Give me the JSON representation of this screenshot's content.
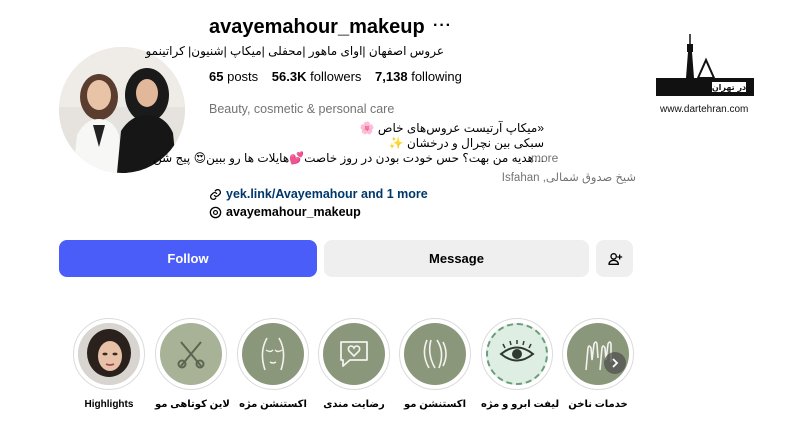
{
  "profile": {
    "username": "avayemahour_makeup",
    "full_name": "عروس اصفهان |اوای ماهور |محفلی |میکاپ |شنیون| کراتینمو",
    "stats": [
      {
        "count": "65",
        "label": "posts"
      },
      {
        "count": "56.3K",
        "label": "followers"
      },
      {
        "count": "7,138",
        "label": "following"
      }
    ],
    "category": "Beauty, cosmetic & personal care",
    "bio_lines": [
      "«میکاپ آرتیست عروس‌های خاص 🌸",
      "سبکی بین نچرال و درخشان ✨",
      "...هدیه من بهت؟ حس خودت بودن در روز خاصت💕هایلات ها رو ببین😍 پیج شن"
    ],
    "bio_more": "more",
    "address": "شیخ صدوق شمالی, Isfahan",
    "link": "yek.link/Avayemahour and 1 more",
    "threads": "avayemahour_makeup"
  },
  "actions": {
    "follow": "Follow",
    "message": "Message"
  },
  "highlights": [
    {
      "label": "Highlights",
      "icon": "portrait-photo"
    },
    {
      "label": "لاین کوتاهی مو",
      "icon": "scissors-comb-icon"
    },
    {
      "label": "اکستنشن مژه",
      "icon": "eyelash-face-icon"
    },
    {
      "label": "رضایت مندی",
      "icon": "heart-chat-icon"
    },
    {
      "label": "اکستنشن مو",
      "icon": "hair-extension-icon"
    },
    {
      "label": "لیفت ابرو و مژه",
      "icon": "eye-icon"
    },
    {
      "label": "خدمات ناخن",
      "icon": "nail-hands-icon"
    }
  ],
  "colors": {
    "follow_button": "#4a5df9",
    "secondary_button": "#efefef",
    "link": "#00376b",
    "highlight_sage": "#8e9b7e"
  },
  "watermark": {
    "text": "در تهران",
    "url": "www.dartehran.com"
  }
}
